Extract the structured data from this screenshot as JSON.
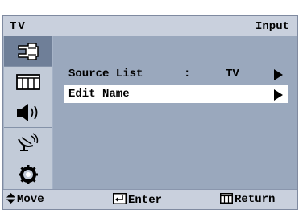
{
  "header": {
    "title_left": "TV",
    "title_right": "Input"
  },
  "sidebar": {
    "items": [
      {
        "icon": "input-icon",
        "selected": true
      },
      {
        "icon": "picture-icon",
        "selected": false
      },
      {
        "icon": "sound-icon",
        "selected": false
      },
      {
        "icon": "channel-icon",
        "selected": false
      },
      {
        "icon": "setup-icon",
        "selected": false
      }
    ]
  },
  "menu": {
    "items": [
      {
        "label": "Source List",
        "separator": ":",
        "value": "TV",
        "highlighted": false
      },
      {
        "label": "Edit Name",
        "separator": "",
        "value": "",
        "highlighted": true
      }
    ]
  },
  "footer": {
    "move": "Move",
    "enter": "Enter",
    "return": "Return"
  },
  "colors": {
    "panel": "#9aa8bd",
    "bar": "#c9d0dd",
    "selected": "#6f7f98",
    "highlight": "#ffffff"
  }
}
